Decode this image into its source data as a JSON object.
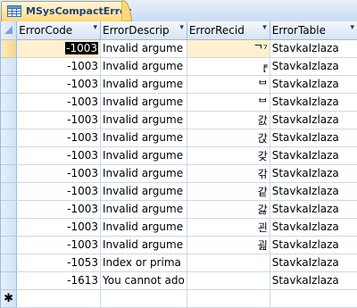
{
  "tab": {
    "title": "MSysCompactError",
    "icon": "table-icon"
  },
  "columns": [
    {
      "label": "ErrorCode",
      "width": 95
    },
    {
      "label": "ErrorDescrip",
      "width": 94
    },
    {
      "label": "ErrorRecid",
      "width": 94
    },
    {
      "label": "ErrorTable",
      "width": 99
    }
  ],
  "rows": [
    {
      "code": "-1003",
      "desc": "Invalid argume",
      "recid": "ᄀ⁷",
      "table": "StavkaIzlaza"
    },
    {
      "code": "-1003",
      "desc": "Invalid argume",
      "recid": "╒̣",
      "table": "StavkaIzlaza"
    },
    {
      "code": "-1003",
      "desc": "Invalid argume",
      "recid": "ᄇ",
      "table": "StavkaIzlaza"
    },
    {
      "code": "-1003",
      "desc": "Invalid argume",
      "recid": "ᄇ",
      "table": "StavkaIzlaza"
    },
    {
      "code": "-1003",
      "desc": "Invalid argume",
      "recid": "갌",
      "table": "StavkaIzlaza"
    },
    {
      "code": "-1003",
      "desc": "Invalid argume",
      "recid": "갅",
      "table": "StavkaIzlaza"
    },
    {
      "code": "-1003",
      "desc": "Invalid argume",
      "recid": "갖",
      "table": "StavkaIzlaza"
    },
    {
      "code": "-1003",
      "desc": "Invalid argume",
      "recid": "갂",
      "table": "StavkaIzlaza"
    },
    {
      "code": "-1003",
      "desc": "Invalid argume",
      "recid": "같",
      "table": "StavkaIzlaza"
    },
    {
      "code": "-1003",
      "desc": "Invalid argume",
      "recid": "갏",
      "table": "StavkaIzlaza"
    },
    {
      "code": "-1003",
      "desc": "Invalid argume",
      "recid": "괸",
      "table": "StavkaIzlaza"
    },
    {
      "code": "-1003",
      "desc": "Invalid argume",
      "recid": "굂",
      "table": "StavkaIzlaza"
    },
    {
      "code": "-1053",
      "desc": "Index or prima",
      "recid": "",
      "table": "StavkaIzlaza"
    },
    {
      "code": "-1613",
      "desc": "You cannot ado",
      "recid": "",
      "table": "StavkaIzlaza"
    }
  ],
  "new_row_marker": "✱",
  "colors": {
    "tab_accent": "#ffd77a",
    "grid_header": "#d6e4f5",
    "current_record": "#fff1cf"
  }
}
